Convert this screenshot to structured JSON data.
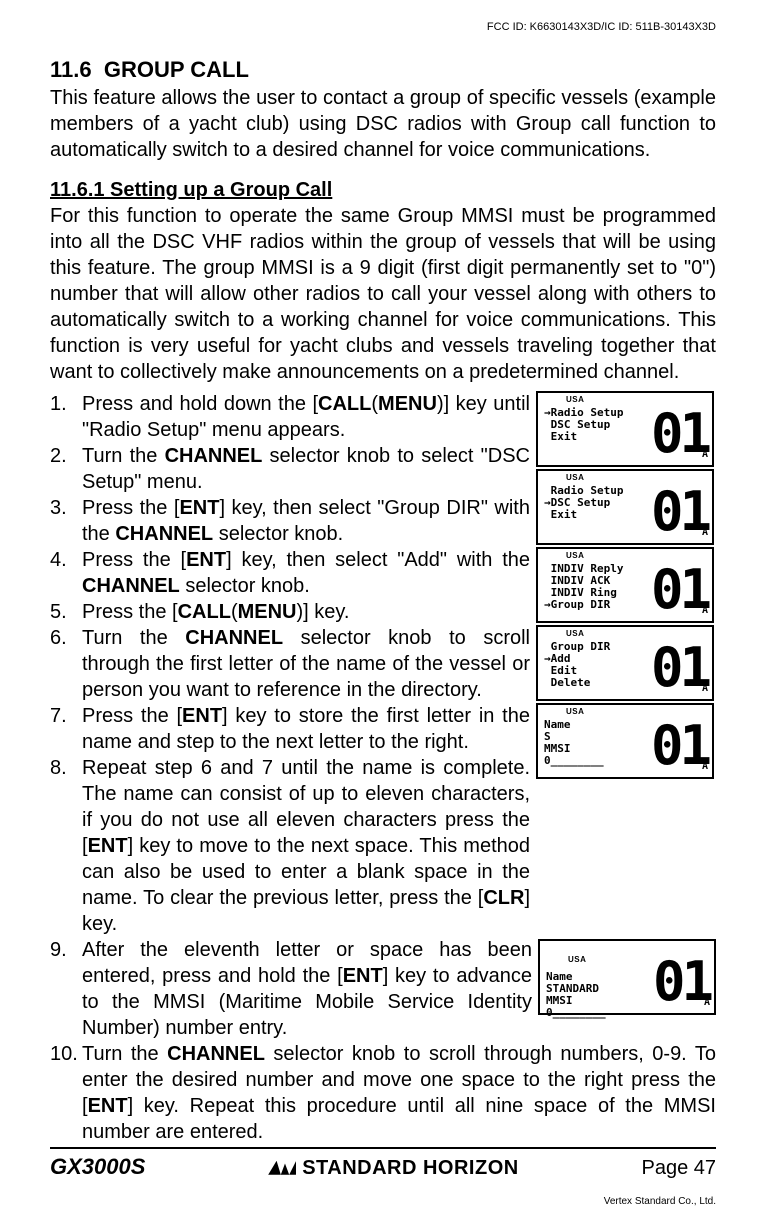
{
  "fcc": "FCC ID: K6630143X3D/IC ID: 511B-30143X3D",
  "section_number": "11.6",
  "section_title": "GROUP CALL",
  "intro": "This feature allows the user to contact a group of specific vessels (example members of a yacht club) using DSC radios with Group call function to automatically switch to a desired channel for voice communications.",
  "subsection": "11.6.1 Setting up a Group Call",
  "subbody": "For this function to operate the same Group MMSI must be programmed into all the DSC VHF radios within the group of vessels that will be using this feature. The group MMSI is a 9 digit (first digit permanently set to \"0\") number that will allow other radios to call your vessel along with others to automatically switch to a working channel for voice communications. This function is very useful for yacht clubs and vessels traveling together that want to collectively make announcements on a predetermined channel.",
  "lcd_big": "01",
  "lcd_sub": "A",
  "usa": "USA",
  "screens": {
    "s1": "→Radio Setup\n DSC Setup\n Exit",
    "s2": " Radio Setup\n→DSC Setup\n Exit",
    "s3": " INDIV Reply\n INDIV ACK\n INDIV Ring\n→Group DIR",
    "s4": " Group DIR\n→Add\n Edit\n Delete",
    "s5": "Name\nS\nMMSI\n0________",
    "s6": "Name\nSTANDARD\nMMSI\n0________"
  },
  "steps": {
    "s1a": "Press and hold down the [",
    "s1b": "CALL",
    "s1c": "(",
    "s1d": "MENU",
    "s1e": ")] key until \"",
    "s1f": "Radio Setup",
    "s1g": "\" menu appears.",
    "s2a": "Turn the ",
    "s2b": "CHANNEL",
    "s2c": " selector knob to select \"",
    "s2d": "DSC Setup",
    "s2e": "\" menu.",
    "s3a": "Press the [",
    "s3b": "ENT",
    "s3c": "] key, then select \"",
    "s3d": "Group DIR",
    "s3e": "\" with the ",
    "s3f": "CHANNEL",
    "s3g": " selector knob.",
    "s4a": "Press the [",
    "s4b": "ENT",
    "s4c": "] key, then select \"",
    "s4d": "Add",
    "s4e": "\" with the ",
    "s4f": "CHANNEL",
    "s4g": " selector knob.",
    "s5a": "Press the [",
    "s5b": "CALL",
    "s5c": "(",
    "s5d": "MENU",
    "s5e": ")] key.",
    "s6a": "Turn the ",
    "s6b": "CHANNEL",
    "s6c": " selector knob to scroll through the first letter of the name of the vessel or person you want to reference in the directory.",
    "s7a": "Press the [",
    "s7b": "ENT",
    "s7c": "] key to store the first letter in the name and step to the next letter to the right.",
    "s8a": "Repeat step 6 and 7 until the name is complete. The name can consist of up to eleven characters, if you do not use all eleven characters press the [",
    "s8b": "ENT",
    "s8c": "] key to move to the next space. This method can also be used to enter a blank space in the name. To clear the previous letter, press the [",
    "s8d": "CLR",
    "s8e": "] key.",
    "s9a": "After the eleventh letter or space has been entered, press and hold the [",
    "s9b": "ENT",
    "s9c": "] key to advance to the MMSI (Maritime Mobile Service Identity Number) number entry.",
    "s10a": "Turn the ",
    "s10b": "CHANNEL",
    "s10c": " selector knob to scroll through numbers, 0-9. To enter the desired number and move one space to the right press the [",
    "s10d": "ENT",
    "s10e": "] key. Repeat this procedure until all nine space of the MMSI number are entered."
  },
  "nums": {
    "n1": "1.",
    "n2": "2.",
    "n3": "3.",
    "n4": "4.",
    "n5": "5.",
    "n6": "6.",
    "n7": "7.",
    "n8": "8.",
    "n9": "9.",
    "n10": "10."
  },
  "footer": {
    "model": "GX3000S",
    "brand": "STANDARD HORIZON",
    "page": "Page 47",
    "vertex": "Vertex Standard Co., Ltd."
  }
}
